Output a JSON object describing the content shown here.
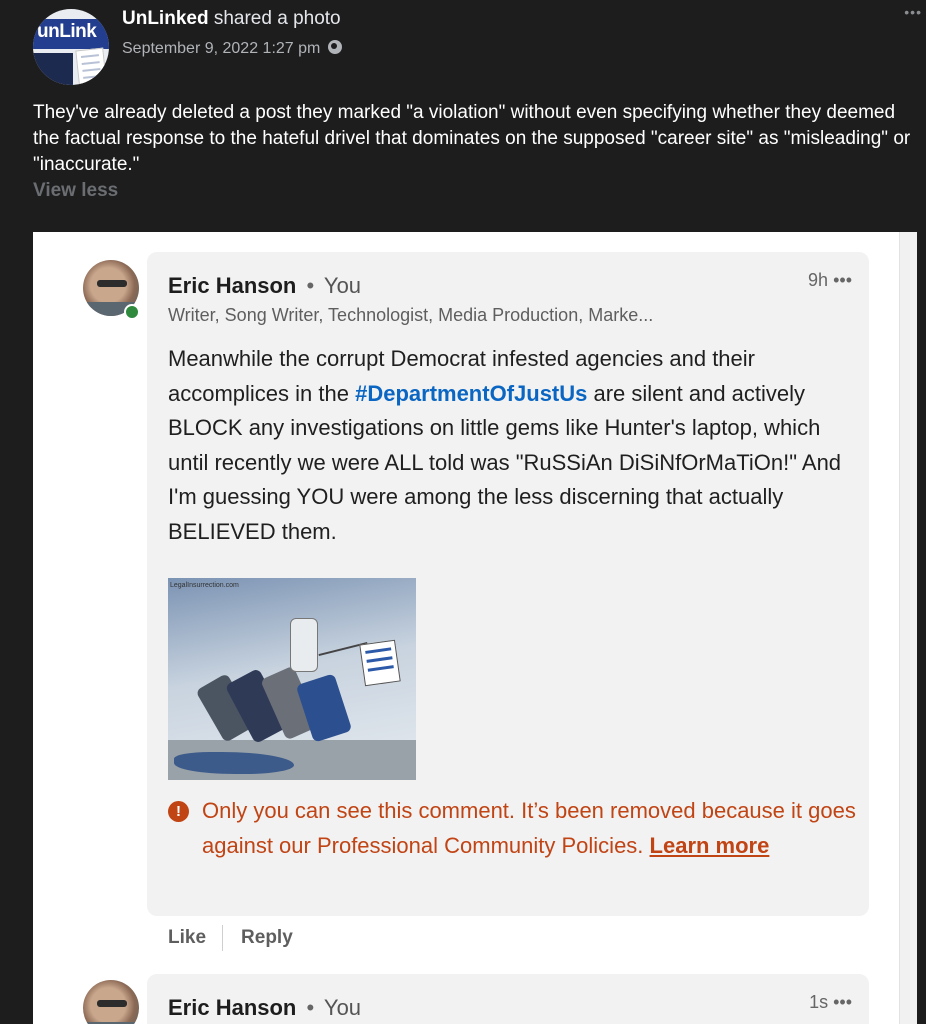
{
  "post": {
    "author": "UnLinked",
    "action": "shared a photo",
    "date": "September 9, 2022 1:27 pm",
    "avatar_text": "unLink",
    "text": "They've already deleted a post they marked \"a violation\" without even specifying whether they deemed the factual response to the hateful drivel that dominates on the supposed \"career site\" as \"misleading\" or \"inaccurate.\"",
    "view_less_label": "View less",
    "more_label": "•••"
  },
  "comment1": {
    "name": "Eric Hanson",
    "separator": "•",
    "you_label": "You",
    "time": "9h",
    "more_label": "•••",
    "headline": "Writer, Song Writer, Technologist, Media Production, Marke...",
    "body_before": "Meanwhile the corrupt Democrat infested agencies and their accomplices in the ",
    "hashtag": "#DepartmentOfJustUs",
    "body_after": " are silent and actively BLOCK any investigations on little gems like Hunter's laptop, which until recently we were ALL told was \"RuSSiAn DiSiNfOrMaTiOn!\" And I'm guessing YOU were among the less discerning that actually BELIEVED them.",
    "image_credit": "LegalInsurrection.com",
    "warning_icon": "!",
    "warning_text": "Only you can see this comment. It’s been removed because it goes against our Professional Community Policies. ",
    "learn_more": "Learn more",
    "like_label": "Like",
    "reply_label": "Reply"
  },
  "comment2": {
    "name": "Eric Hanson",
    "separator": "•",
    "you_label": "You",
    "time": "1s",
    "more_label": "•••"
  },
  "colors": {
    "warning": "#c14414",
    "hashtag": "#0a66c2",
    "online": "#2f8a3e"
  }
}
